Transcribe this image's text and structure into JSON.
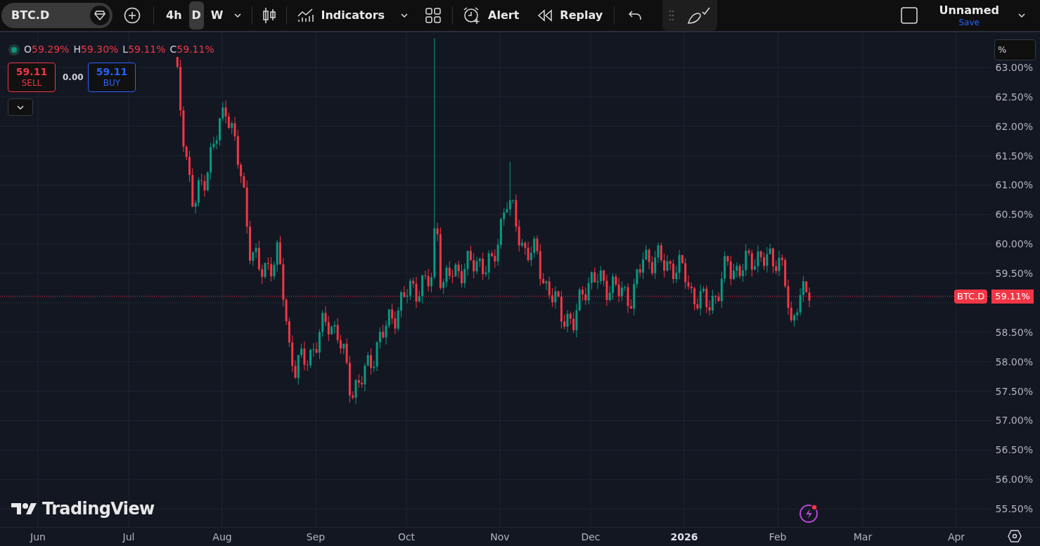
{
  "toolbar": {
    "symbol": "BTC.D",
    "intervals": [
      {
        "label": "4h",
        "selected": false
      },
      {
        "label": "D",
        "selected": true
      },
      {
        "label": "W",
        "selected": false
      }
    ],
    "indicators": "Indicators",
    "alert": "Alert",
    "replay": "Replay",
    "layout_name": "Unnamed",
    "save": "Save"
  },
  "legend": [
    {
      "label": "O",
      "value": "59.29%"
    },
    {
      "label": "H",
      "value": "59.30%"
    },
    {
      "label": "L",
      "value": "59.11%"
    },
    {
      "label": "C",
      "value": "59.11%"
    }
  ],
  "trade": {
    "sell_price": "59.11",
    "sell_label": "SELL",
    "spread": "0.00",
    "buy_price": "59.11",
    "buy_label": "BUY"
  },
  "price_scale": {
    "mode": "%",
    "ticks_above": [
      "63.00%",
      "62.50%",
      "62.00%",
      "61.50%",
      "61.00%",
      "60.50%",
      "60.00%",
      "59.50%"
    ],
    "ticks_below": [
      "58.50%",
      "58.00%",
      "57.50%",
      "57.00%",
      "56.50%",
      "56.00%",
      "55.50%"
    ]
  },
  "current_price": {
    "symbol": "BTC.D",
    "value": "59.11%"
  },
  "time_axis": [
    {
      "label": "Jun",
      "bold": false
    },
    {
      "label": "Jul",
      "bold": false
    },
    {
      "label": "Aug",
      "bold": false
    },
    {
      "label": "Sep",
      "bold": false
    },
    {
      "label": "Oct",
      "bold": false
    },
    {
      "label": "Nov",
      "bold": false
    },
    {
      "label": "Dec",
      "bold": false
    },
    {
      "label": "2026",
      "bold": true
    },
    {
      "label": "Feb",
      "bold": false
    },
    {
      "label": "Mar",
      "bold": false
    },
    {
      "label": "Apr",
      "bold": false
    }
  ],
  "brand": "TradingView"
}
